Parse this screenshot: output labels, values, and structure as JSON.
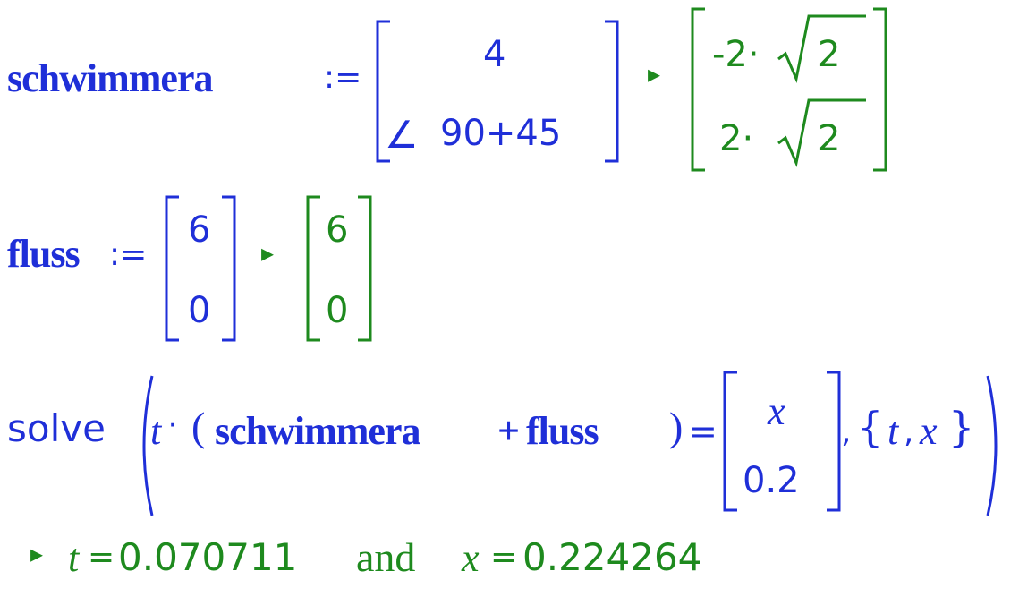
{
  "line1": {
    "var_name": "schwimmera",
    "assign": ":=",
    "mat_top": "4",
    "mat_bottom_angle": "∠",
    "mat_bottom_expr": "90+45",
    "result_arrow": "▸",
    "res_top_coef": "-2·",
    "res_top_rad": "2",
    "res_bottom_coef": "2·",
    "res_bottom_rad": "2",
    "input_color": "#1f2fd8",
    "output_color": "#1e8a1e"
  },
  "line2": {
    "var_name": "fluss",
    "assign": ":=",
    "mat_top": "6",
    "mat_bottom": "0",
    "result_arrow": "▸",
    "res_top": "6",
    "res_bottom": "0"
  },
  "line3": {
    "func": "solve",
    "t_var": "t",
    "mul": "·",
    "paren_open": "(",
    "expr_a": "schwimmera",
    "plus": "+",
    "expr_b": "fluss",
    "paren_close": ")",
    "equals": "=",
    "mat_top": "x",
    "mat_bottom": "0.2",
    "comma": ",",
    "set_open": "{",
    "set_t": "t",
    "set_comma": ",",
    "set_x": "x",
    "set_close": "}"
  },
  "line4": {
    "result_arrow": "▸",
    "t_var": "t",
    "eq1": "=",
    "t_value": "0.070711",
    "and_word": "and",
    "x_var": "x",
    "eq2": "=",
    "x_value": "0.224264"
  }
}
